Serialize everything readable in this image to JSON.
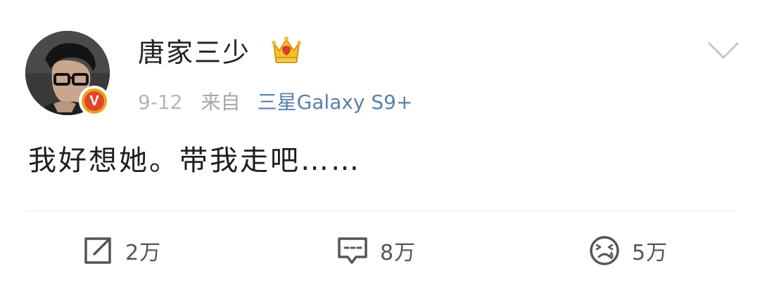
{
  "post": {
    "user": {
      "name": "唐家三少",
      "avatar_icon": "avatar-photo",
      "verified_icon": "verified-v-badge",
      "crown_icon": "crown-icon"
    },
    "meta": {
      "time": "9-12",
      "source_prefix": "来自",
      "device": "三星Galaxy S9+"
    },
    "content": "我好想她。带我走吧……",
    "actions": {
      "repost_count": "2万",
      "comment_count": "8万",
      "like_count": "5万"
    }
  },
  "colors": {
    "device_link": "#5a7fae",
    "meta_gray": "#b5b5b5",
    "badge_red": "#e0452b",
    "badge_gold": "#e8a31c"
  }
}
